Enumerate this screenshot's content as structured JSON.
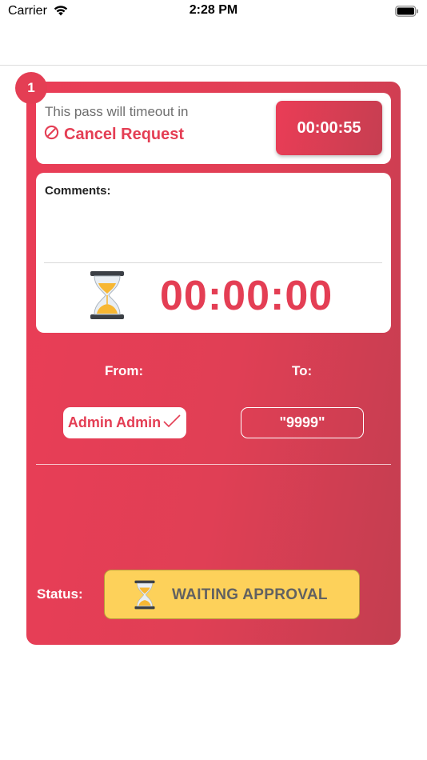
{
  "status_bar": {
    "carrier": "Carrier",
    "time": "2:28 PM",
    "icons": [
      "wifi-icon",
      "battery-icon"
    ]
  },
  "card": {
    "index": "1",
    "timeout_label": "This pass will timeout in",
    "cancel_label": "Cancel Request",
    "timeout_countdown": "00:00:55",
    "comments_label": "Comments:",
    "elapsed_time": "00:00:00",
    "from_label": "From:",
    "to_label": "To:",
    "from_value": "Admin Admin",
    "to_value": "\"9999\"",
    "status_label": "Status:",
    "status_value": "WAITING APPROVAL"
  },
  "colors": {
    "accent": "#e43e54",
    "status_yellow": "#fdd15a",
    "status_text": "#616161"
  }
}
